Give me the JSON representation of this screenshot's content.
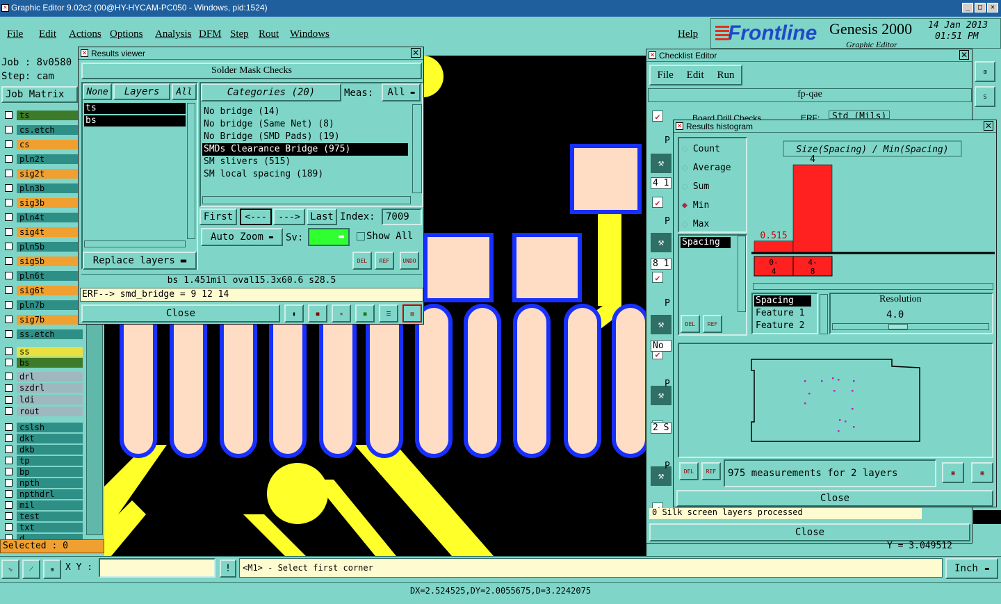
{
  "app": {
    "title": "Graphic Editor 9.02c2 (00@HY-HYCAM-PC050 - Windows, pid:1524)",
    "menu": [
      "File",
      "Edit",
      "Actions",
      "Options",
      "Analysis",
      "DFM",
      "Step",
      "Rout",
      "Windows"
    ],
    "help": "Help",
    "brand": "Frontline",
    "product": "Genesis 2000",
    "product_sub": "Graphic Editor",
    "date": "14 Jan 2013",
    "time": "01:51 PM"
  },
  "left_panel": {
    "job": "Job : 8v0580",
    "step": "Step: cam",
    "matrix_label": "Job Matrix",
    "layers": [
      {
        "name": "ts",
        "color": "#3d7a2a"
      },
      {
        "name": "cs.etch",
        "color": "#2e8f86"
      },
      {
        "name": "cs",
        "color": "#f0a030"
      },
      {
        "name": "pln2t",
        "color": "#2e8f86"
      },
      {
        "name": "sig2t",
        "color": "#f0a030"
      },
      {
        "name": "pln3b",
        "color": "#2e8f86"
      },
      {
        "name": "sig3b",
        "color": "#f0a030"
      },
      {
        "name": "pln4t",
        "color": "#2e8f86"
      },
      {
        "name": "sig4t",
        "color": "#f0a030"
      },
      {
        "name": "pln5b",
        "color": "#2e8f86"
      },
      {
        "name": "sig5b",
        "color": "#f0a030"
      },
      {
        "name": "pln6t",
        "color": "#2e8f86"
      },
      {
        "name": "sig6t",
        "color": "#f0a030"
      },
      {
        "name": "pln7b",
        "color": "#2e8f86"
      },
      {
        "name": "sig7b",
        "color": "#f0a030"
      },
      {
        "name": "ss.etch",
        "color": "#2e8f86"
      },
      {
        "name": "ss",
        "color": "#e8e040"
      },
      {
        "name": "bs",
        "color": "#3d7a2a"
      },
      {
        "name": "drl",
        "color": "#9fb8c0"
      },
      {
        "name": "szdrl",
        "color": "#9fb8c0"
      },
      {
        "name": "ldi",
        "color": "#9fb8c0"
      },
      {
        "name": "rout",
        "color": "#9fb8c0"
      },
      {
        "name": "cslsh",
        "color": "#2e8f86"
      },
      {
        "name": "dkt",
        "color": "#2e8f86"
      },
      {
        "name": "dkb",
        "color": "#2e8f86"
      },
      {
        "name": "tp",
        "color": "#2e8f86"
      },
      {
        "name": "bp",
        "color": "#2e8f86"
      },
      {
        "name": "npth",
        "color": "#2e8f86"
      },
      {
        "name": "npthdrl",
        "color": "#2e8f86"
      },
      {
        "name": "mil",
        "color": "#2e8f86"
      },
      {
        "name": "test",
        "color": "#2e8f86"
      },
      {
        "name": "txt",
        "color": "#2e8f86"
      },
      {
        "name": "d",
        "color": "#2e8f86"
      }
    ],
    "selected": "Selected : 0"
  },
  "results_viewer": {
    "title": "Results viewer",
    "header": "Solder Mask Checks",
    "none": "None",
    "layers_label": "Layers",
    "all": "All",
    "layer_items": [
      "ts",
      "bs"
    ],
    "categories_label": "Categories (20)",
    "meas_label": "Meas:",
    "meas_value": "All",
    "categories": [
      "No bridge (14)",
      "No bridge (Same Net) (8)",
      "No Bridge (SMD Pads) (19)",
      "SMDs Clearance Bridge (975)",
      "SM slivers (515)",
      "SM local spacing (189)"
    ],
    "selected_category": 3,
    "first": "First",
    "prev": "<---",
    "next": "--->",
    "last": "Last",
    "index_label": "Index:",
    "index_value": "7009",
    "auto_zoom": "Auto Zoom",
    "sv_label": "Sv:",
    "show_all": "Show All",
    "replace_layers": "Replace layers",
    "del": "DEL",
    "ref": "REF",
    "undo": "UNDO",
    "info_line": "bs 1.451mil  oval15.3x60.6  s28.5",
    "erf_line": "ERF--> smd_bridge = 9 12 14",
    "close": "Close"
  },
  "checklist": {
    "title": "Checklist Editor",
    "menu": [
      "File",
      "Edit",
      "Run"
    ],
    "name": "fp-qae",
    "row_partial": "Board Drill Checks",
    "erf_partial": "ERF:",
    "std_partial": "Std (Mils)",
    "side_codes": [
      "P",
      "4 1",
      "P",
      "8 1",
      "P",
      "No",
      "P",
      "2 S",
      "P"
    ],
    "status": "0 Silk screen layers processed",
    "close": "Close"
  },
  "histogram": {
    "title": "Results histogram",
    "options": [
      "Count",
      "Average",
      "Sum",
      "Min",
      "Max"
    ],
    "selected_option": "Min",
    "list_item": "Spacing",
    "chart_title": "Size(Spacing) / Min(Spacing)",
    "del": "DEL",
    "ref": "REF",
    "fields": [
      "Spacing",
      "Feature 1",
      "Feature 2"
    ],
    "resolution_label": "Resolution",
    "resolution_value": "4.0",
    "summary": "975 measurements for 2 layers",
    "close": "Close"
  },
  "chart_data": {
    "type": "bar",
    "title": "Size(Spacing) / Min(Spacing)",
    "categories": [
      "0-4",
      "4-8"
    ],
    "values": [
      0.515,
      4
    ],
    "data_labels": [
      "0.515",
      "4"
    ],
    "bar_color": "#ff2020"
  },
  "bottom": {
    "xy_label": "X Y :",
    "prompt": "<M1> - Select first corner",
    "units": "Inch",
    "coord_readout": "Y = 3.049512",
    "status": "DX=2.524525,DY=2.0055675,D=3.2242075"
  }
}
